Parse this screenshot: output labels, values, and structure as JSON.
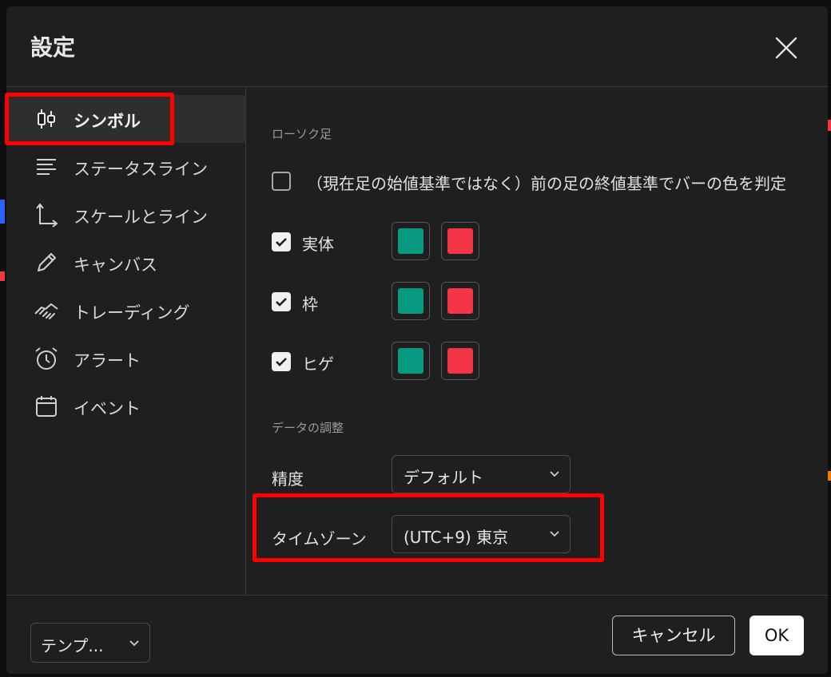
{
  "dialog": {
    "title": "設定"
  },
  "sidebar": {
    "items": [
      {
        "label": "シンボル",
        "icon": "candlestick-icon"
      },
      {
        "label": "ステータスライン",
        "icon": "lines-icon"
      },
      {
        "label": "スケールとライン",
        "icon": "axis-icon"
      },
      {
        "label": "キャンバス",
        "icon": "pencil-icon"
      },
      {
        "label": "トレーディング",
        "icon": "handshake-icon"
      },
      {
        "label": "アラート",
        "icon": "alarm-clock-icon"
      },
      {
        "label": "イベント",
        "icon": "calendar-icon"
      }
    ]
  },
  "candles": {
    "section_label": "ローソク足",
    "prev_close_label": "（現在足の始値基準ではなく）前の足の終値基準でバーの色を判定",
    "rows": [
      {
        "label": "実体",
        "checked": true,
        "up_color": "#089981",
        "down_color": "#f23645"
      },
      {
        "label": "枠",
        "checked": true,
        "up_color": "#089981",
        "down_color": "#f23645"
      },
      {
        "label": "ヒゲ",
        "checked": true,
        "up_color": "#089981",
        "down_color": "#f23645"
      }
    ]
  },
  "data_adjust": {
    "section_label": "データの調整",
    "precision_label": "精度",
    "precision_value": "デフォルト",
    "timezone_label": "タイムゾーン",
    "timezone_value": "(UTC+9) 東京"
  },
  "footer": {
    "template_label": "テンプ...",
    "cancel_label": "キャンセル",
    "ok_label": "OK"
  },
  "colors": {
    "highlight": "#ff0000",
    "up": "#089981",
    "down": "#f23645"
  }
}
